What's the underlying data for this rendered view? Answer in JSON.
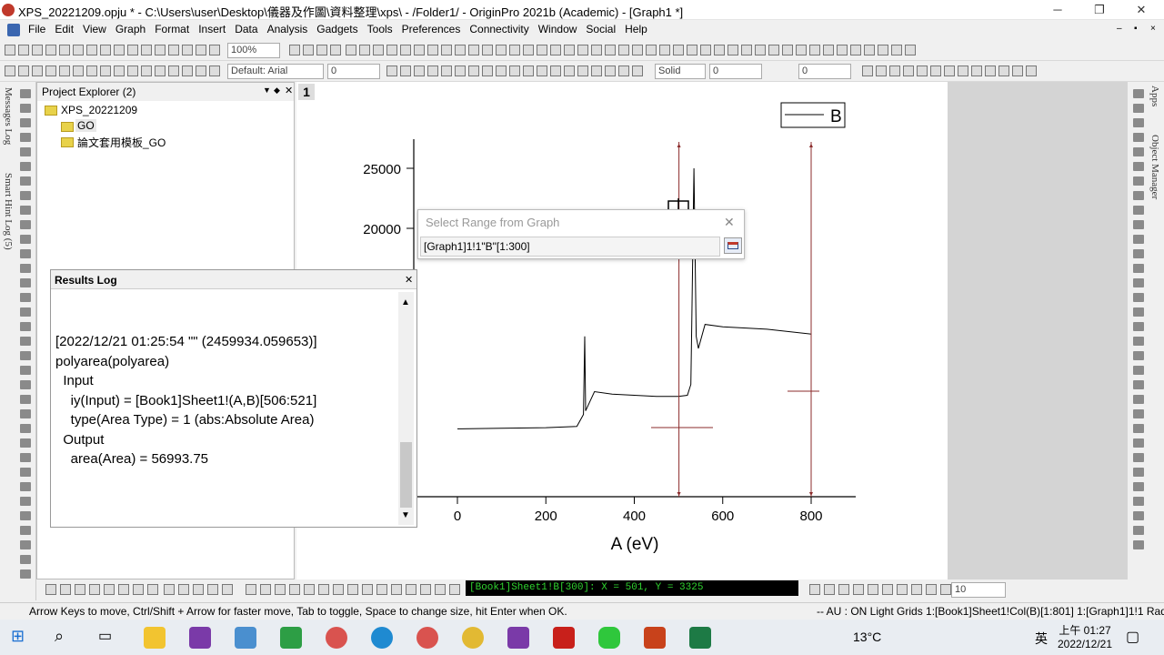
{
  "window": {
    "title": "XPS_20221209.opju * - C:\\Users\\user\\Desktop\\儀器及作圖\\資料整理\\xps\\ - /Folder1/ - OriginPro 2021b (Academic) - [Graph1 *]"
  },
  "menu": [
    "File",
    "Edit",
    "View",
    "Graph",
    "Format",
    "Insert",
    "Data",
    "Analysis",
    "Gadgets",
    "Tools",
    "Preferences",
    "Connectivity",
    "Window",
    "Social",
    "Help"
  ],
  "toolbar": {
    "zoom": "100%",
    "font": "Default: Arial",
    "font_size": "0",
    "line_style": "Solid",
    "line_width": "0",
    "fill": "0",
    "bottom_value": "10"
  },
  "side_tabs": {
    "messages": "Messages Log",
    "smart_hint": "Smart Hint Log (5)",
    "apps": "Apps",
    "object_manager": "Object Manager"
  },
  "project_explorer": {
    "title": "Project Explorer (2)",
    "root": "XPS_20221209",
    "folders": [
      "GO",
      "論文套用模板_GO"
    ]
  },
  "graph": {
    "layer_tab": "1",
    "legend": "B",
    "xlabel": "A (eV)",
    "xticks": [
      "0",
      "200",
      "400",
      "600",
      "800"
    ],
    "yticks": [
      "25000",
      "20000"
    ]
  },
  "chart_data": {
    "type": "line",
    "series": [
      {
        "name": "B",
        "points": [
          [
            0,
            3300
          ],
          [
            100,
            3350
          ],
          [
            200,
            3400
          ],
          [
            270,
            3500
          ],
          [
            285,
            4500
          ],
          [
            288,
            11000
          ],
          [
            290,
            4800
          ],
          [
            310,
            6400
          ],
          [
            350,
            6200
          ],
          [
            400,
            6100
          ],
          [
            450,
            6000
          ],
          [
            500,
            6000
          ],
          [
            520,
            6100
          ],
          [
            528,
            7000
          ],
          [
            530,
            12000
          ],
          [
            535,
            25000
          ],
          [
            540,
            11000
          ],
          [
            545,
            10000
          ],
          [
            560,
            12000
          ],
          [
            600,
            11800
          ],
          [
            700,
            11600
          ],
          [
            800,
            11200
          ]
        ]
      }
    ],
    "xlim": [
      -20,
      850
    ],
    "ylim": [
      0,
      28000
    ],
    "markers_x": [
      501,
      800
    ]
  },
  "results_log": {
    "title": "Results Log",
    "lines": [
      "[2022/12/21 01:25:54 \"\" (2459934.059653)]",
      "polyarea(polyarea)",
      "  Input",
      "    iy(Input) = [Book1]Sheet1!(A,B)[506:521]",
      "    type(Area Type) = 1 (abs:Absolute Area)",
      "  Output",
      "    area(Area) = 56993.75"
    ]
  },
  "select_range": {
    "title": "Select Range from Graph",
    "value": "[Graph1]1!1\"B\"[1:300]"
  },
  "coord_readout": "[Book1]Sheet1!B[300]:  X = 501, Y = 3325",
  "status": {
    "hint": "Arrow Keys to move, Ctrl/Shift + Arrow for faster move, Tab to toggle,  Space to change size, hit Enter when OK.",
    "right": "--  AU : ON Light Grids 1:[Book1]Sheet1!Col(B)[1:801] 1:[Graph1]1!1 Radian"
  },
  "taskbar": {
    "temp": "13°C",
    "ime": "英",
    "time": "上午 01:27",
    "date": "2022/12/21"
  }
}
